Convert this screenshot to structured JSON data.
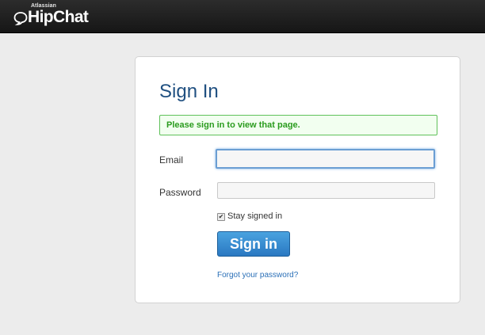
{
  "header": {
    "brand_top": "Atlassian",
    "brand_name": "HipChat",
    "logo_icon": "speech-bubble-icon"
  },
  "signin": {
    "title": "Sign In",
    "alert": "Please sign in to view that page.",
    "email_label": "Email",
    "email_value": "",
    "password_label": "Password",
    "password_value": "",
    "stay_signed_in_label": "Stay signed in",
    "stay_signed_in_checked": true,
    "submit_label": "Sign in",
    "forgot_link": "Forgot your password?"
  },
  "colors": {
    "title": "#205081",
    "alert_text": "#2a9b1e",
    "alert_border": "#5fc15a",
    "button": "#2a78c2",
    "link": "#2a6fb7",
    "topbar": "#1e1e1e"
  }
}
